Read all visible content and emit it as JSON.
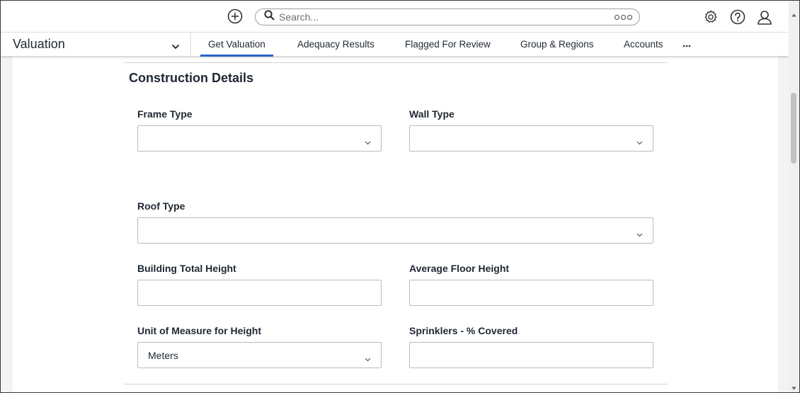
{
  "header": {
    "search_placeholder": "Search...",
    "icons": [
      "add-icon",
      "search-icon",
      "search-options-icon",
      "settings-icon",
      "help-icon",
      "user-icon"
    ]
  },
  "nav": {
    "app_title": "Valuation",
    "tabs": [
      {
        "label": "Get Valuation",
        "active": true
      },
      {
        "label": "Adequacy Results",
        "active": false
      },
      {
        "label": "Flagged For Review",
        "active": false
      },
      {
        "label": "Group & Regions",
        "active": false
      },
      {
        "label": "Accounts",
        "active": false
      }
    ],
    "more_icon": "more-horizontal-icon"
  },
  "form": {
    "section_title": "Construction Details",
    "frame_type": {
      "label": "Frame Type",
      "value": ""
    },
    "wall_type": {
      "label": "Wall Type",
      "value": ""
    },
    "roof_type": {
      "label": "Roof Type",
      "value": ""
    },
    "building_total_height": {
      "label": "Building Total Height",
      "value": ""
    },
    "average_floor_height": {
      "label": "Average Floor Height",
      "value": ""
    },
    "unit_of_measure": {
      "label": "Unit of Measure for Height",
      "value": "Meters"
    },
    "sprinklers_covered": {
      "label": "Sprinklers - % Covered",
      "value": ""
    }
  },
  "colors": {
    "accent": "#2a63c8",
    "text": "#1f2733",
    "border": "#b8bcc2"
  }
}
